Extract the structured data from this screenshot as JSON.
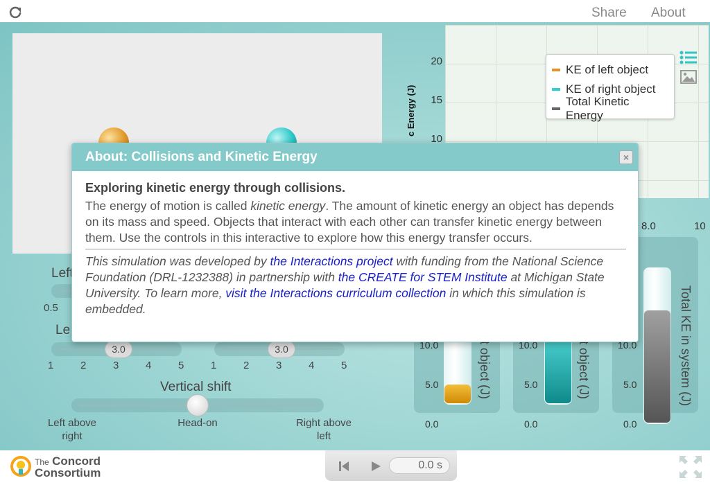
{
  "header": {
    "share_label": "Share",
    "about_label": "About",
    "reload_icon": "reload-icon"
  },
  "graph": {
    "ylabel_visible": "c Energy (J)",
    "y_ticks": [
      "20",
      "15",
      "10"
    ],
    "x_ticks": [
      "8.0",
      "10"
    ],
    "legend": [
      {
        "label": "KE of left object",
        "color": "#e8912a"
      },
      {
        "label": "KE of right object",
        "color": "#2fcfcf"
      },
      {
        "label": "Total Kinetic Energy",
        "color": "#666666"
      }
    ]
  },
  "controls": {
    "left_label_partial": "Left",
    "left_min_visible": "0.5",
    "left2_label_partial": "Le",
    "mass_left_value": "3.0",
    "mass_right_value": "3.0",
    "scale_ticks": [
      "1",
      "2",
      "3",
      "4",
      "5"
    ],
    "vertical_shift": {
      "label": "Vertical shift",
      "left_text_1": "Left above",
      "left_text_2": "right",
      "center_text": "Head-on",
      "right_text_1": "Right above",
      "right_text_2": "left"
    }
  },
  "meters": [
    {
      "label": "t object (J)",
      "ticks": [
        "10.0",
        "5.0",
        "0.0"
      ],
      "fill_fraction": 0.13,
      "color": "#e8a010"
    },
    {
      "label": "t object (J)",
      "ticks": [
        "10.0",
        "5.0",
        "0.0"
      ],
      "fill_fraction": 0.6,
      "color": "#22c0c0"
    },
    {
      "label": "Total KE in system (J)",
      "ticks": [
        "10.0",
        "5.0",
        "0.0"
      ],
      "fill_fraction": 0.73,
      "color": "#777777"
    }
  ],
  "footer": {
    "logo_small": "The",
    "logo_big_1": "Concord",
    "logo_big_2": "Consortium",
    "time": "0.0 s"
  },
  "modal": {
    "title": "About: Collisions and Kinetic Energy",
    "close_label": "×",
    "heading": "Exploring kinetic energy through collisions.",
    "para_1": "The energy of motion is called ",
    "para_italic": "kinetic energy",
    "para_2": ". The amount of kinetic energy an object has depends on its mass and speed. Objects that interact with each other can transfer kinetic energy between them. Use the controls in this interactive to explore how this energy transfer occurs.",
    "credit_1": "This simulation was developed by ",
    "credit_link_1": "the Interactions project",
    "credit_2": " with funding from the National Science Foundation (DRL-1232388) in partnership with ",
    "credit_link_2": "the CREATE for STEM Institute",
    "credit_3": " at Michigan State University. To learn more, ",
    "credit_link_3": "visit the Interactions curriculum collection",
    "credit_4": " in which this simulation is embedded."
  }
}
